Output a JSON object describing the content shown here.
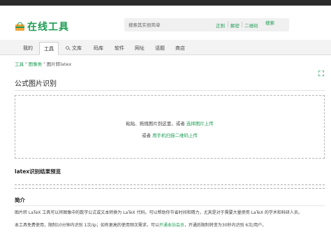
{
  "header": {
    "logo_text": "在线工具"
  },
  "search": {
    "placeholder": "搜索其实很简单",
    "options": [
      "正则",
      "解密",
      "二维码"
    ],
    "button_label": "搜索"
  },
  "nav": {
    "items": [
      {
        "label": "我的",
        "active": false
      },
      {
        "label": "工具",
        "active": true
      },
      {
        "label": "文库",
        "active": false,
        "icon": "magnifier-icon"
      },
      {
        "label": "码库",
        "active": false
      },
      {
        "label": "软件",
        "active": false
      },
      {
        "label": "网址",
        "active": false
      },
      {
        "label": "话题",
        "active": false
      },
      {
        "label": "商店",
        "active": false
      }
    ]
  },
  "breadcrumb": {
    "items": [
      "工具",
      "图像类",
      "图片转latex"
    ],
    "separator": "›"
  },
  "page": {
    "title": "公式图片识别"
  },
  "upload": {
    "line1_prefix": "粘贴、拖拽图片到这里，或者",
    "line1_link": "选择图片上传",
    "line2_prefix": "或者",
    "line2_link": "用手机扫描二维码上传"
  },
  "preview": {
    "title": "latex识别结果预览"
  },
  "intro": {
    "title": "简介",
    "p1": "图片转 LaTeX 工具可以将图像中的数学公式或文本转换为 LaTeX 代码。可以帮助你节省时间和精力，尤其是对于需要大量使用 LaTeX 的学术和科研人员。",
    "p2_prefix": "本工具免费使用，限制10分钟内识别 1次/ip；如有更高的使用频次需求，可以",
    "p2_link": "开通本站会员",
    "p2_suffix": "，开通后限制将变为30秒内识别 6次/用户。"
  },
  "colors": {
    "accent": "#1f9d55",
    "topbar": "#2b2b2b",
    "logo_bag": "#f2a43a"
  }
}
